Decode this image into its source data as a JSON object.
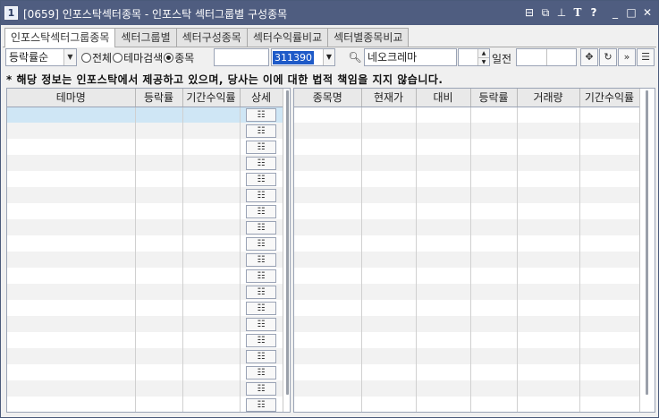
{
  "window": {
    "number": "1",
    "title": "[0659] 인포스탁섹터종목 - 인포스탁 섹터그룹별 구성종목",
    "icons": [
      "restore-window-icon",
      "copy-window-icon",
      "pin-icon",
      "text-size-icon",
      "help-icon",
      "minimize-icon",
      "maximize-icon",
      "close-icon"
    ]
  },
  "tabs": [
    {
      "label": "인포스탁섹터그룹종목",
      "active": true
    },
    {
      "label": "섹터그룹별",
      "active": false
    },
    {
      "label": "섹터구성종목",
      "active": false
    },
    {
      "label": "섹터수익률비교",
      "active": false
    },
    {
      "label": "섹터별종목비교",
      "active": false
    }
  ],
  "toolbar": {
    "sort_value": "등락률순",
    "radios": [
      {
        "label": "전체",
        "checked": false
      },
      {
        "label": "테마검색",
        "checked": false
      },
      {
        "label": "종목",
        "checked": true
      }
    ],
    "stock_code": "311390",
    "stock_name": "네오크레마",
    "days_label": "일전"
  },
  "notice": "* 해당 정보는 인포스탁에서 제공하고 있으며, 당사는 이에 대한 법적 책임을 지지 않습니다.",
  "left_grid": {
    "headers": [
      "테마명",
      "등락률",
      "기간수익률",
      "상세"
    ],
    "row_count": 19,
    "detail_icon": "detail-icon"
  },
  "right_grid": {
    "headers": [
      "종목명",
      "현재가",
      "대비",
      "등락률",
      "거래량",
      "기간수익률"
    ],
    "row_count": 19
  }
}
